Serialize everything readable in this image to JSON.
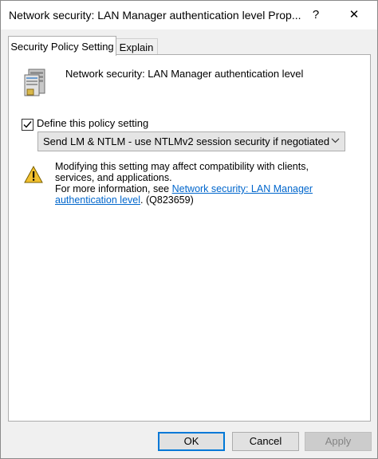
{
  "window": {
    "title": "Network security: LAN Manager authentication level Prop...",
    "help_glyph": "?",
    "close_glyph": "✕"
  },
  "tabs": [
    {
      "label": "Security Policy Setting",
      "active": true
    },
    {
      "label": "Explain",
      "active": false
    }
  ],
  "policy": {
    "icon": "server-icon",
    "name": "Network security: LAN Manager authentication level"
  },
  "define": {
    "label": "Define this policy setting",
    "checked": true
  },
  "dropdown": {
    "selected": "Send LM & NTLM - use NTLMv2 session security if negotiated"
  },
  "warning": {
    "icon": "warning-icon",
    "line1": "Modifying this setting may affect compatibility with clients, services, and applications.",
    "line2_prefix": "For more information, see ",
    "link_text": "Network security: LAN Manager authentication level",
    "line2_suffix": ". (Q823659)"
  },
  "buttons": {
    "ok": "OK",
    "cancel": "Cancel",
    "apply": "Apply"
  },
  "colors": {
    "link": "#0066cc",
    "focus_border": "#0078d7"
  }
}
